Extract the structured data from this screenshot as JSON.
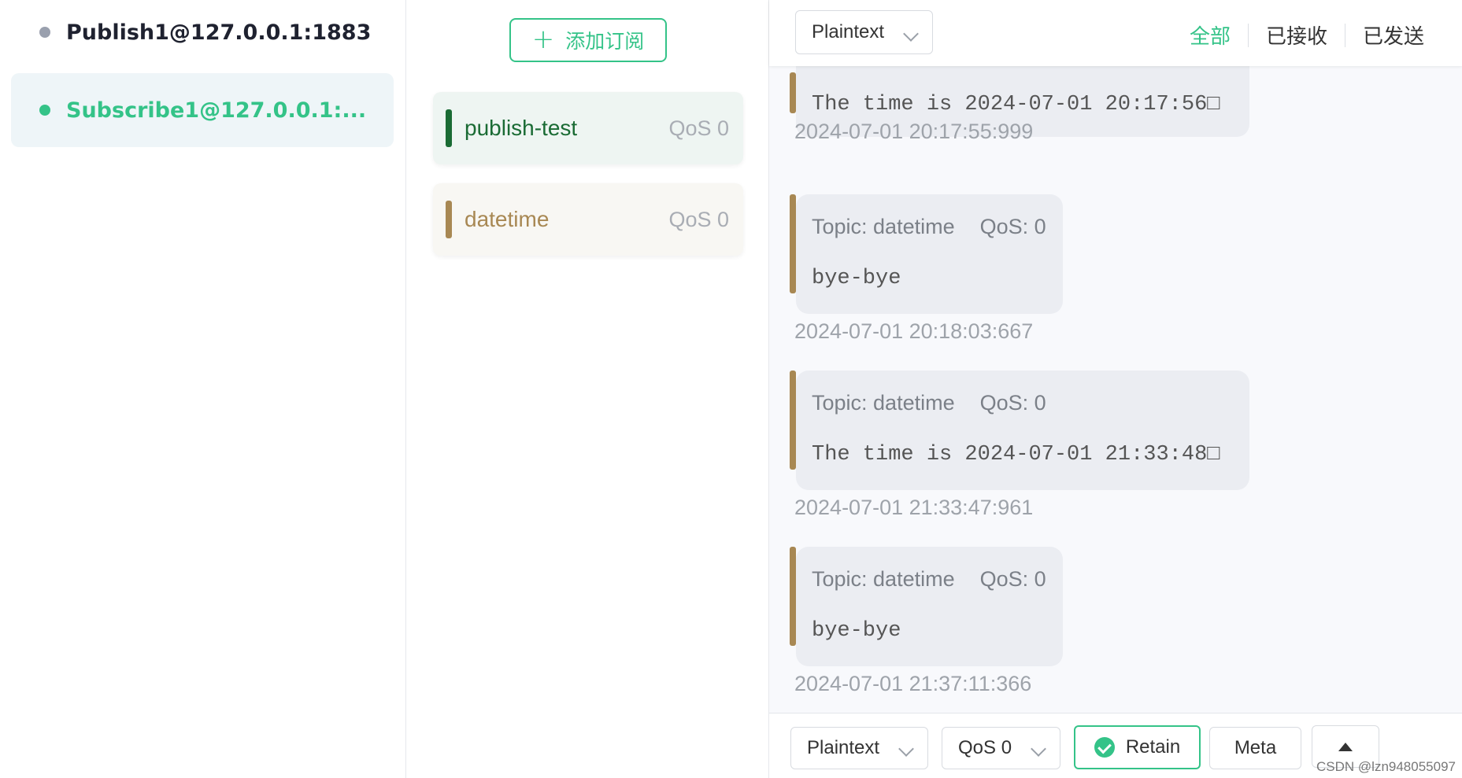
{
  "connections": [
    {
      "label": "Publish1@127.0.0.1:1883",
      "dot_color": "#9aa0ae",
      "text_color": "#1f2230",
      "active": false
    },
    {
      "label": "Subscribe1@127.0.0.1:...",
      "dot_color": "#34c388",
      "text_color": "#34c388",
      "active": true
    }
  ],
  "subscriptions": {
    "add_button_icon": "+",
    "add_button_label": "添加订阅",
    "items": [
      {
        "topic": "publish-test",
        "qos": "QoS 0",
        "color": "#1a6b34",
        "bg": "#eef5f2"
      },
      {
        "topic": "datetime",
        "qos": "QoS 0",
        "color": "#a88853",
        "bg": "#f8f7f3"
      }
    ]
  },
  "header": {
    "payload_format": "Plaintext",
    "filters": [
      "全部",
      "已接收",
      "已发送"
    ],
    "active_filter": "全部"
  },
  "messages": [
    {
      "meta": false,
      "payload": "The time is 2024-07-01 20:17:56□",
      "time": "2024-07-01 20:17:55:999"
    },
    {
      "meta": true,
      "topic": "Topic: datetime",
      "qos": "QoS: 0",
      "payload": "bye-bye",
      "time": "2024-07-01 20:18:03:667"
    },
    {
      "meta": true,
      "topic": "Topic: datetime",
      "qos": "QoS: 0",
      "payload": "The time is 2024-07-01 21:33:48□",
      "time": "2024-07-01 21:33:47:961"
    },
    {
      "meta": true,
      "topic": "Topic: datetime",
      "qos": "QoS: 0",
      "payload": "bye-bye",
      "time": "2024-07-01 21:37:11:366"
    }
  ],
  "composer": {
    "format": "Plaintext",
    "qos": "QoS 0",
    "retain_label": "Retain",
    "retain_checked": true,
    "meta_label": "Meta"
  },
  "watermark": "CSDN @lzn948055097",
  "colors": {
    "accent": "#34c388",
    "message_bar": "#a88853"
  }
}
